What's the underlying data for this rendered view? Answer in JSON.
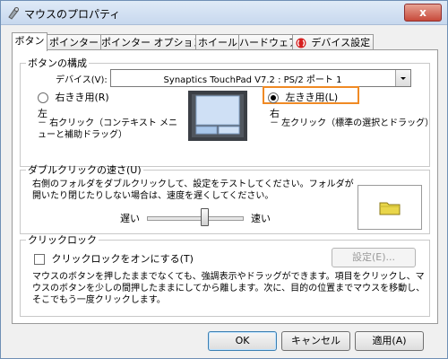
{
  "window": {
    "title": "マウスのプロパティ",
    "close_glyph": "x"
  },
  "tabs": [
    {
      "label": "ボタン"
    },
    {
      "label": "ポインター"
    },
    {
      "label": "ポインター オプション"
    },
    {
      "label": "ホイール"
    },
    {
      "label": "ハードウェア"
    },
    {
      "label": "デバイス設定"
    }
  ],
  "button_config": {
    "title": "ボタンの構成",
    "device_label": "デバイス(V):",
    "device_value": "Synaptics TouchPad V7.2 : PS/2 ポート 1",
    "right_handed_label": "右きき用(R)",
    "left_handed_label": "左きき用(L)",
    "left_caption": "左",
    "left_desc": "－ 右クリック（コンテキスト メニューと補助ドラッグ）",
    "right_caption": "右",
    "right_desc": "－ 左クリック（標準の選択とドラッグ）",
    "highlight_color": "#f08a24"
  },
  "double_click": {
    "title": "ダブルクリックの速さ(U)",
    "description": "右側のフォルダをダブルクリックして、設定をテストしてください。フォルダが開いたり閉じたりしない場合は、速度を遅くしてください。",
    "slow_label": "遅い",
    "fast_label": "速い",
    "speed_level": 0.6
  },
  "click_lock": {
    "title": "クリックロック",
    "checkbox_label": "クリックロックをオンにする(T)",
    "settings_button": "設定(E)...",
    "description": "マウスのボタンを押したままでなくても、強調表示やドラッグができます。項目をクリックし、マウスのボタンを少しの間押したままにしてから離します。次に、目的の位置までマウスを移動し、そこでもう一度クリックします。"
  },
  "footer": {
    "ok": "OK",
    "cancel": "キャンセル",
    "apply": "適用(A)"
  }
}
